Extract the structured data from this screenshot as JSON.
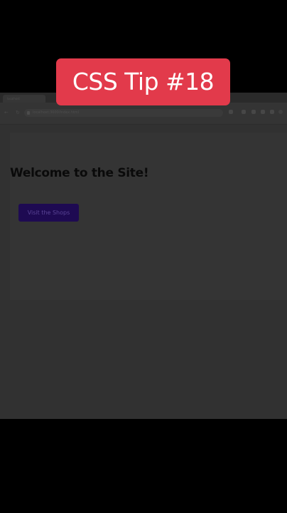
{
  "overlay": {
    "caption": "CSS Tip #18",
    "caption_color": "#e23a4b"
  },
  "browser": {
    "tab_title": "localhost",
    "address": "localhost:3000/index.html",
    "icons": {
      "back": "arrow-left-icon",
      "reload": "reload-icon"
    }
  },
  "page": {
    "heading": "Welcome to the Site!",
    "button_label": "Visit the Shops",
    "button_color": "#1e0a52"
  }
}
